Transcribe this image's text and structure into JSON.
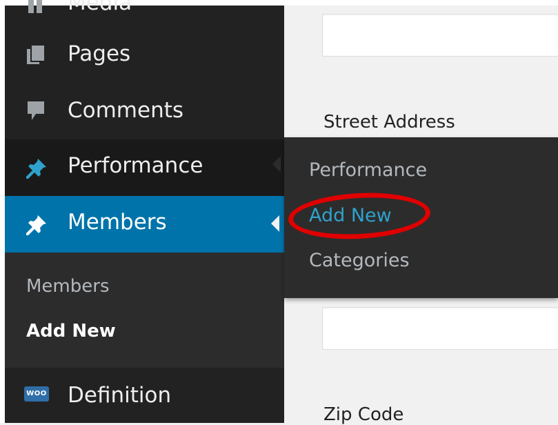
{
  "sidebar": {
    "items": [
      {
        "label": "Media",
        "icon": "media-icon"
      },
      {
        "label": "Pages",
        "icon": "pages-icon"
      },
      {
        "label": "Comments",
        "icon": "comments-icon"
      },
      {
        "label": "Performance",
        "icon": "pin-icon"
      },
      {
        "label": "Members",
        "icon": "pin-icon"
      },
      {
        "label": "Definition",
        "icon": "woo-icon"
      }
    ],
    "submenu": {
      "members": "Members",
      "add_new": "Add New"
    },
    "woo_badge": "WOO"
  },
  "flyout": {
    "items": [
      "Performance",
      "Add New",
      "Categories"
    ],
    "highlight_color": "#e00000"
  },
  "form": {
    "labels": {
      "street_address": "Street Address",
      "zip_code": "Zip Code"
    }
  },
  "colors": {
    "sidebar_bg": "#222222",
    "active_bg": "#0073aa",
    "link_blue": "#2ea2cc",
    "submenu_text": "#b4b9be"
  }
}
